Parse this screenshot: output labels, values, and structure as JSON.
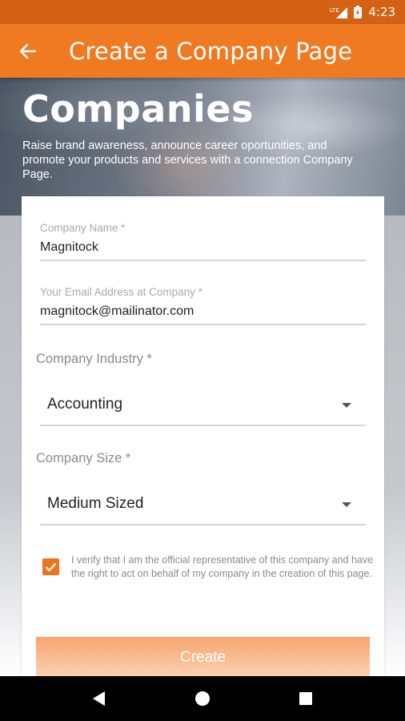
{
  "status_bar": {
    "time": "4:23",
    "network_label": "LTE"
  },
  "app_bar": {
    "title": "Create a Company Page",
    "back_icon": "arrow-left-icon"
  },
  "hero": {
    "heading": "Companies",
    "description": "Raise brand awareness, announce career oportunities, and promote your products and services with a connection Company Page."
  },
  "form": {
    "company_name": {
      "label": "Company Name *",
      "value": "Magnitock"
    },
    "email": {
      "label": "Your Email Address at Company *",
      "value": "magnitock@mailinator.com"
    },
    "industry": {
      "label": "Company Industry *",
      "selected": "Accounting"
    },
    "size": {
      "label": "Company Size *",
      "selected": "Medium Sized"
    },
    "verify": {
      "checked": true,
      "text": "I verify that I am the official representative of this company and have the right to act on behalf of my company in the creation of this page."
    },
    "submit_label": "Create"
  },
  "colors": {
    "primary": "#ef7a22",
    "status_bar": "#d56214",
    "checkbox": "#ee7520"
  }
}
